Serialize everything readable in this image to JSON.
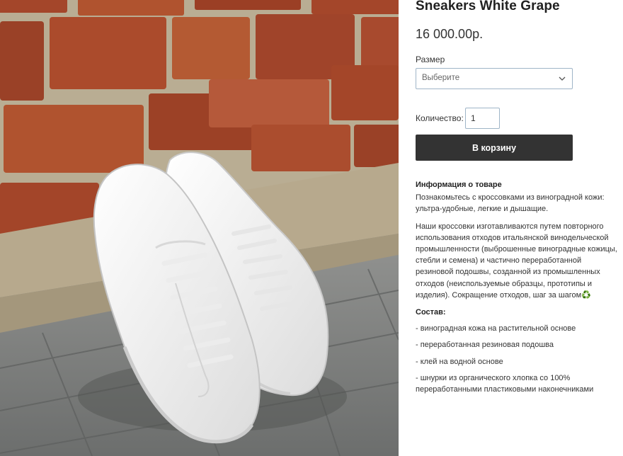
{
  "product": {
    "title": "Sneakers White Grape",
    "price": "16 000.00р.",
    "image_alt_icon": "product-photo"
  },
  "options": {
    "size_label": "Размер",
    "size_placeholder": "Выберите",
    "quantity_label": "Количество:",
    "quantity_value": "1"
  },
  "actions": {
    "add_to_cart": "В корзину"
  },
  "description": {
    "heading": "Информация о товаре",
    "intro": "Познакомьтесь с кроссовками из виноградной кожи: ультра-удобные, легкие и дышащие.",
    "body": "Наши кроссовки изготавливаются путем повторного использования отходов итальянской винодельческой промышленности (выброшенные виноградные кожицы, стебли и семена) и частично переработанной резиновой подошвы, созданной из промышленных отходов (неиспользуемые образцы, прототипы и изделия). Сокращение отходов, шаг за шагом♻️",
    "composition_heading": "Состав:",
    "composition": [
      "- виноградная кожа на растительной основе",
      "- переработанная резиновая подошва",
      "- клей на водной основе",
      "- шнурки из органического хлопка со 100% переработанными пластиковыми наконечниками"
    ]
  },
  "colors": {
    "button_bg": "#333333",
    "input_border": "#9fb5c7",
    "brick": "#a4462a",
    "mortar": "#b9ad93",
    "paving": "#7d7f7e"
  }
}
